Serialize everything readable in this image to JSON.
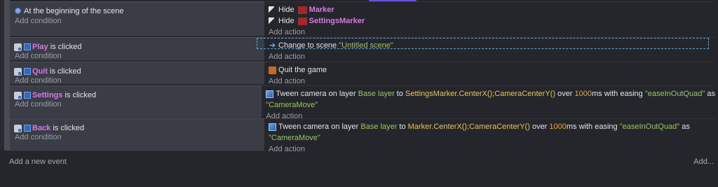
{
  "events": [
    {
      "condition_parts": [
        {
          "kind": "plain",
          "text": "At the beginning of the scene"
        }
      ],
      "condition_icon": "scene-start-icon",
      "add_condition": "Add condition",
      "actions": [
        {
          "icon": "hide-icon",
          "parts": [
            {
              "kind": "plain",
              "text": "Hide"
            },
            {
              "kind": "swatch"
            },
            {
              "kind": "obj",
              "text": "Marker"
            }
          ]
        },
        {
          "icon": "hide-icon",
          "parts": [
            {
              "kind": "plain",
              "text": "Hide"
            },
            {
              "kind": "swatch"
            },
            {
              "kind": "obj",
              "text": "SettingsMarker"
            }
          ]
        }
      ],
      "add_action": "Add action"
    },
    {
      "condition_parts": [
        {
          "kind": "obj",
          "text": "Play"
        },
        {
          "kind": "plain",
          "text": " is clicked"
        }
      ],
      "condition_icon": "button-click-icon",
      "add_condition": "Add condition",
      "actions": [
        {
          "icon": "change-scene-icon",
          "parts": [
            {
              "kind": "plain",
              "text": "Change to scene "
            },
            {
              "kind": "str",
              "text": "\"Untitled scene\""
            }
          ]
        }
      ],
      "add_action": "Add action"
    },
    {
      "condition_parts": [
        {
          "kind": "obj",
          "text": "Quit"
        },
        {
          "kind": "plain",
          "text": " is clicked"
        }
      ],
      "condition_icon": "button-click-icon",
      "add_condition": "Add condition",
      "actions": [
        {
          "icon": "quit-game-icon",
          "parts": [
            {
              "kind": "plain",
              "text": "Quit the game"
            }
          ]
        }
      ],
      "add_action": "Add action"
    },
    {
      "condition_parts": [
        {
          "kind": "obj",
          "text": "Settings"
        },
        {
          "kind": "plain",
          "text": " is clicked"
        }
      ],
      "condition_icon": "button-click-icon",
      "add_condition": "Add condition",
      "actions": [
        {
          "icon": "tween-camera-icon",
          "parts": [
            {
              "kind": "plain",
              "text": "Tween camera on layer "
            },
            {
              "kind": "layer",
              "text": "Base layer"
            },
            {
              "kind": "plain",
              "text": " to "
            },
            {
              "kind": "expr",
              "text": "SettingsMarker.CenterX();CameraCenterY()"
            },
            {
              "kind": "plain",
              "text": " over "
            },
            {
              "kind": "num",
              "text": "1000"
            },
            {
              "kind": "plain",
              "text": "ms with easing "
            },
            {
              "kind": "str",
              "text": "\"easeInOutQuad\""
            },
            {
              "kind": "plain",
              "text": " as"
            }
          ]
        },
        {
          "icon": "",
          "parts": [
            {
              "kind": "str",
              "text": "\"CameraMove\""
            }
          ]
        }
      ],
      "add_action": "Add action"
    },
    {
      "condition_parts": [
        {
          "kind": "obj",
          "text": "Back"
        },
        {
          "kind": "plain",
          "text": " is clicked"
        }
      ],
      "condition_icon": "button-click-icon",
      "add_condition": "Add condition",
      "actions": [
        {
          "icon": "tween-camera-icon",
          "parts": [
            {
              "kind": "plain",
              "text": "Tween camera on layer "
            },
            {
              "kind": "layer",
              "text": "Base layer"
            },
            {
              "kind": "plain",
              "text": " to "
            },
            {
              "kind": "expr",
              "text": "Marker.CenterX();CameraCenterY()"
            },
            {
              "kind": "plain",
              "text": " over "
            },
            {
              "kind": "num",
              "text": "1000"
            },
            {
              "kind": "plain",
              "text": "ms with easing "
            },
            {
              "kind": "str",
              "text": "\"easeInOutQuad\""
            },
            {
              "kind": "plain",
              "text": " as"
            }
          ]
        },
        {
          "icon": "",
          "parts": [
            {
              "kind": "str",
              "text": "\"CameraMove\""
            }
          ]
        }
      ],
      "add_action": "Add action"
    }
  ],
  "footer": {
    "add_event": "Add a new event",
    "add_more": "Add..."
  }
}
